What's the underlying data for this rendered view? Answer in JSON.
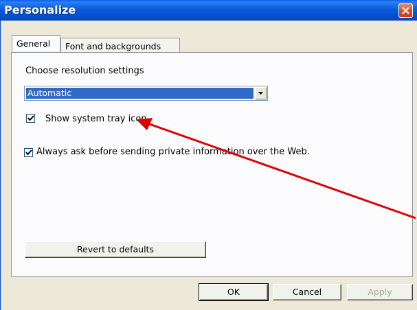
{
  "window": {
    "title": "Personalize"
  },
  "tabs": [
    {
      "label": "General",
      "active": true
    },
    {
      "label": "Font and backgrounds",
      "active": false
    }
  ],
  "general": {
    "resolution_label": "Choose resolution settings",
    "resolution_value": "Automatic",
    "tray_icon_label": "Show system tray icon.",
    "tray_icon_checked": true,
    "private_info_label": "Always ask before sending private information over the Web.",
    "private_info_checked": true,
    "revert_label": "Revert to defaults"
  },
  "footer": {
    "ok_label": "OK",
    "cancel_label": "Cancel",
    "apply_label": "Apply"
  },
  "colors": {
    "titlebar": "#0a5fe8",
    "selection": "#316ac5",
    "annotation_arrow": "#e00000"
  }
}
